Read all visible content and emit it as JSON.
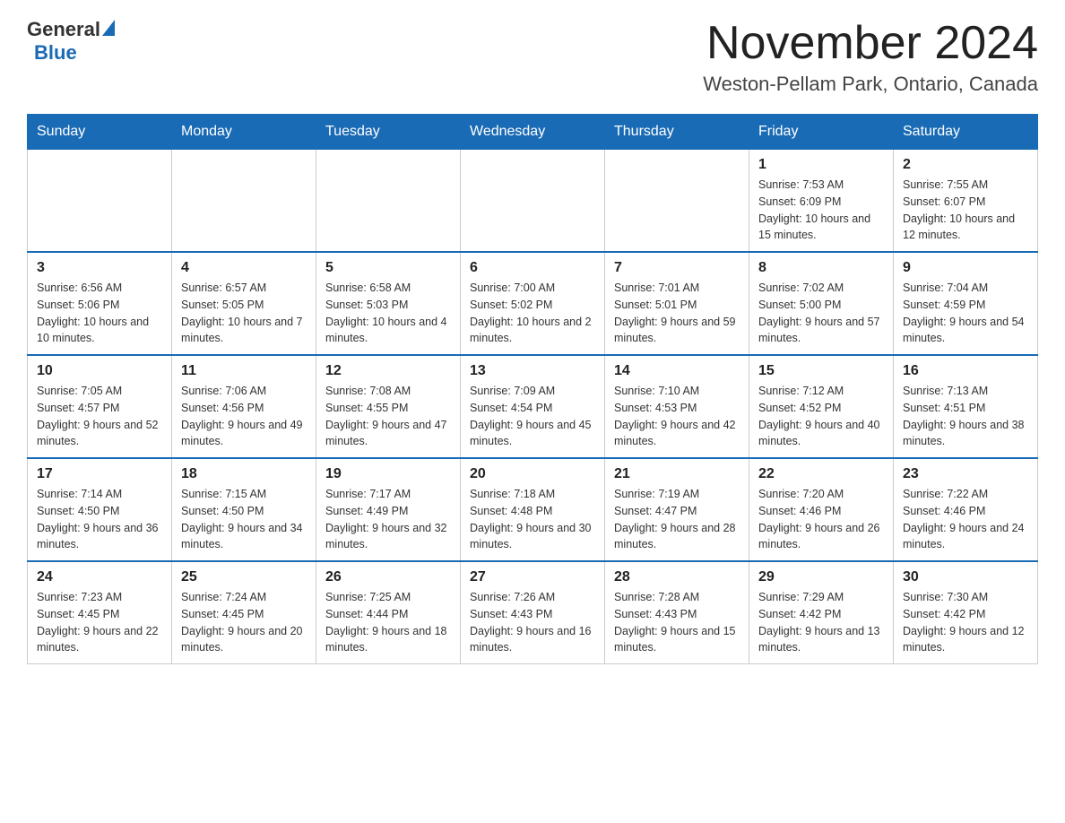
{
  "header": {
    "logo_general": "General",
    "logo_blue": "Blue",
    "month_title": "November 2024",
    "location": "Weston-Pellam Park, Ontario, Canada"
  },
  "days_of_week": [
    "Sunday",
    "Monday",
    "Tuesday",
    "Wednesday",
    "Thursday",
    "Friday",
    "Saturday"
  ],
  "weeks": [
    [
      {
        "day": "",
        "sunrise": "",
        "sunset": "",
        "daylight": ""
      },
      {
        "day": "",
        "sunrise": "",
        "sunset": "",
        "daylight": ""
      },
      {
        "day": "",
        "sunrise": "",
        "sunset": "",
        "daylight": ""
      },
      {
        "day": "",
        "sunrise": "",
        "sunset": "",
        "daylight": ""
      },
      {
        "day": "",
        "sunrise": "",
        "sunset": "",
        "daylight": ""
      },
      {
        "day": "1",
        "sunrise": "Sunrise: 7:53 AM",
        "sunset": "Sunset: 6:09 PM",
        "daylight": "Daylight: 10 hours and 15 minutes."
      },
      {
        "day": "2",
        "sunrise": "Sunrise: 7:55 AM",
        "sunset": "Sunset: 6:07 PM",
        "daylight": "Daylight: 10 hours and 12 minutes."
      }
    ],
    [
      {
        "day": "3",
        "sunrise": "Sunrise: 6:56 AM",
        "sunset": "Sunset: 5:06 PM",
        "daylight": "Daylight: 10 hours and 10 minutes."
      },
      {
        "day": "4",
        "sunrise": "Sunrise: 6:57 AM",
        "sunset": "Sunset: 5:05 PM",
        "daylight": "Daylight: 10 hours and 7 minutes."
      },
      {
        "day": "5",
        "sunrise": "Sunrise: 6:58 AM",
        "sunset": "Sunset: 5:03 PM",
        "daylight": "Daylight: 10 hours and 4 minutes."
      },
      {
        "day": "6",
        "sunrise": "Sunrise: 7:00 AM",
        "sunset": "Sunset: 5:02 PM",
        "daylight": "Daylight: 10 hours and 2 minutes."
      },
      {
        "day": "7",
        "sunrise": "Sunrise: 7:01 AM",
        "sunset": "Sunset: 5:01 PM",
        "daylight": "Daylight: 9 hours and 59 minutes."
      },
      {
        "day": "8",
        "sunrise": "Sunrise: 7:02 AM",
        "sunset": "Sunset: 5:00 PM",
        "daylight": "Daylight: 9 hours and 57 minutes."
      },
      {
        "day": "9",
        "sunrise": "Sunrise: 7:04 AM",
        "sunset": "Sunset: 4:59 PM",
        "daylight": "Daylight: 9 hours and 54 minutes."
      }
    ],
    [
      {
        "day": "10",
        "sunrise": "Sunrise: 7:05 AM",
        "sunset": "Sunset: 4:57 PM",
        "daylight": "Daylight: 9 hours and 52 minutes."
      },
      {
        "day": "11",
        "sunrise": "Sunrise: 7:06 AM",
        "sunset": "Sunset: 4:56 PM",
        "daylight": "Daylight: 9 hours and 49 minutes."
      },
      {
        "day": "12",
        "sunrise": "Sunrise: 7:08 AM",
        "sunset": "Sunset: 4:55 PM",
        "daylight": "Daylight: 9 hours and 47 minutes."
      },
      {
        "day": "13",
        "sunrise": "Sunrise: 7:09 AM",
        "sunset": "Sunset: 4:54 PM",
        "daylight": "Daylight: 9 hours and 45 minutes."
      },
      {
        "day": "14",
        "sunrise": "Sunrise: 7:10 AM",
        "sunset": "Sunset: 4:53 PM",
        "daylight": "Daylight: 9 hours and 42 minutes."
      },
      {
        "day": "15",
        "sunrise": "Sunrise: 7:12 AM",
        "sunset": "Sunset: 4:52 PM",
        "daylight": "Daylight: 9 hours and 40 minutes."
      },
      {
        "day": "16",
        "sunrise": "Sunrise: 7:13 AM",
        "sunset": "Sunset: 4:51 PM",
        "daylight": "Daylight: 9 hours and 38 minutes."
      }
    ],
    [
      {
        "day": "17",
        "sunrise": "Sunrise: 7:14 AM",
        "sunset": "Sunset: 4:50 PM",
        "daylight": "Daylight: 9 hours and 36 minutes."
      },
      {
        "day": "18",
        "sunrise": "Sunrise: 7:15 AM",
        "sunset": "Sunset: 4:50 PM",
        "daylight": "Daylight: 9 hours and 34 minutes."
      },
      {
        "day": "19",
        "sunrise": "Sunrise: 7:17 AM",
        "sunset": "Sunset: 4:49 PM",
        "daylight": "Daylight: 9 hours and 32 minutes."
      },
      {
        "day": "20",
        "sunrise": "Sunrise: 7:18 AM",
        "sunset": "Sunset: 4:48 PM",
        "daylight": "Daylight: 9 hours and 30 minutes."
      },
      {
        "day": "21",
        "sunrise": "Sunrise: 7:19 AM",
        "sunset": "Sunset: 4:47 PM",
        "daylight": "Daylight: 9 hours and 28 minutes."
      },
      {
        "day": "22",
        "sunrise": "Sunrise: 7:20 AM",
        "sunset": "Sunset: 4:46 PM",
        "daylight": "Daylight: 9 hours and 26 minutes."
      },
      {
        "day": "23",
        "sunrise": "Sunrise: 7:22 AM",
        "sunset": "Sunset: 4:46 PM",
        "daylight": "Daylight: 9 hours and 24 minutes."
      }
    ],
    [
      {
        "day": "24",
        "sunrise": "Sunrise: 7:23 AM",
        "sunset": "Sunset: 4:45 PM",
        "daylight": "Daylight: 9 hours and 22 minutes."
      },
      {
        "day": "25",
        "sunrise": "Sunrise: 7:24 AM",
        "sunset": "Sunset: 4:45 PM",
        "daylight": "Daylight: 9 hours and 20 minutes."
      },
      {
        "day": "26",
        "sunrise": "Sunrise: 7:25 AM",
        "sunset": "Sunset: 4:44 PM",
        "daylight": "Daylight: 9 hours and 18 minutes."
      },
      {
        "day": "27",
        "sunrise": "Sunrise: 7:26 AM",
        "sunset": "Sunset: 4:43 PM",
        "daylight": "Daylight: 9 hours and 16 minutes."
      },
      {
        "day": "28",
        "sunrise": "Sunrise: 7:28 AM",
        "sunset": "Sunset: 4:43 PM",
        "daylight": "Daylight: 9 hours and 15 minutes."
      },
      {
        "day": "29",
        "sunrise": "Sunrise: 7:29 AM",
        "sunset": "Sunset: 4:42 PM",
        "daylight": "Daylight: 9 hours and 13 minutes."
      },
      {
        "day": "30",
        "sunrise": "Sunrise: 7:30 AM",
        "sunset": "Sunset: 4:42 PM",
        "daylight": "Daylight: 9 hours and 12 minutes."
      }
    ]
  ]
}
